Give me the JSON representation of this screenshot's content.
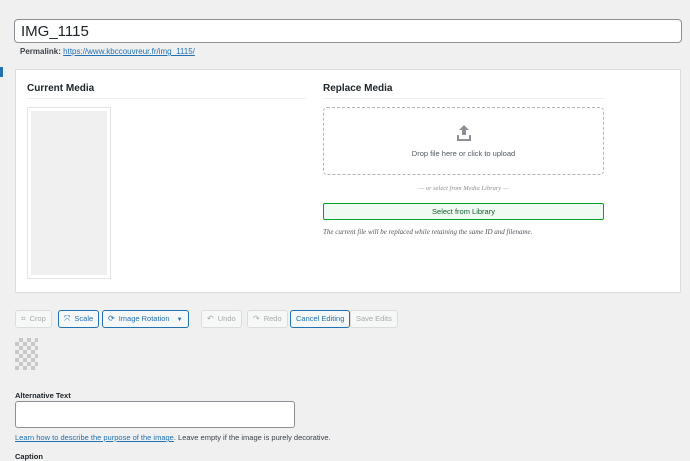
{
  "title": {
    "value": "IMG_1115"
  },
  "permalink": {
    "label": "Permalink:",
    "url": "https://www.kbccouvreur.fr/img_1115/"
  },
  "media": {
    "current_heading": "Current Media",
    "replace_heading": "Replace Media",
    "drop_text": "Drop file here or click to upload",
    "or_select_text": "— or select from Media Library —",
    "select_button": "Select from Library",
    "note": "The current file will be replaced while retaining the same ID and filename."
  },
  "toolbar": {
    "crop": "Crop",
    "scale": "Scale",
    "rotation": "Image Rotation",
    "undo": "Undo",
    "redo": "Redo",
    "cancel": "Cancel Editing",
    "save": "Save Edits"
  },
  "alt": {
    "label": "Alternative Text",
    "value": "",
    "help_link": "Learn how to describe the purpose of the image",
    "help_rest": ". Leave empty if the image is purely decorative."
  },
  "caption": {
    "label": "Caption"
  },
  "colors": {
    "accent": "#2271b1",
    "success": "#00a32a",
    "background": "#f0f0f1"
  },
  "icons": [
    "upload-icon",
    "crop-icon",
    "scale-icon",
    "rotate-icon",
    "chevron-down-icon",
    "undo-icon",
    "redo-icon"
  ]
}
